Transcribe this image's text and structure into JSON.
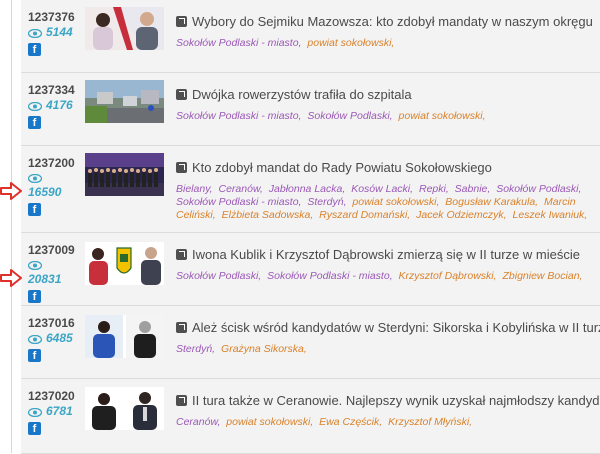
{
  "articles": [
    {
      "id": "1237376",
      "views": "5144",
      "fb_label": "f",
      "title": "Wybory do Sejmiku Mazowsza: kto zdobył mandaty w naszym okręgu",
      "tags": [
        {
          "text": "Sokołów Podlaski - miasto,",
          "color": "purple"
        },
        {
          "text": "powiat sokołowski,",
          "color": "orange"
        }
      ]
    },
    {
      "id": "1237334",
      "views": "4176",
      "fb_label": "f",
      "title": "Dwójka rowerzystów trafiła do szpitala",
      "tags": [
        {
          "text": "Sokołów Podlaski - miasto,",
          "color": "purple"
        },
        {
          "text": "Sokołów Podlaski,",
          "color": "purple"
        },
        {
          "text": "powiat sokołowski,",
          "color": "orange"
        }
      ]
    },
    {
      "id": "1237200",
      "views": "16590",
      "fb_label": "f",
      "title": "Kto zdobył mandat do Rady Powiatu Sokołowskiego",
      "tags": [
        {
          "text": "Bielany,",
          "color": "purple"
        },
        {
          "text": "Ceranów,",
          "color": "purple"
        },
        {
          "text": "Jabłonna Lacka,",
          "color": "purple"
        },
        {
          "text": "Kosów Lacki,",
          "color": "purple"
        },
        {
          "text": "Repki,",
          "color": "purple"
        },
        {
          "text": "Sabnie,",
          "color": "purple"
        },
        {
          "text": "Sokołów Podlaski,",
          "color": "purple"
        },
        {
          "text": "Sokołów Podlaski - miasto,",
          "color": "purple"
        },
        {
          "text": "Sterdyń,",
          "color": "purple"
        },
        {
          "text": "powiat sokołowski,",
          "color": "orange"
        },
        {
          "text": "Bogusław Karakula,",
          "color": "orange"
        },
        {
          "text": "Marcin Celiński,",
          "color": "orange"
        },
        {
          "text": "Elżbieta Sadowska,",
          "color": "orange"
        },
        {
          "text": "Ryszard Domański,",
          "color": "orange"
        },
        {
          "text": "Jacek Odziemczyk,",
          "color": "orange"
        },
        {
          "text": "Leszek Iwaniuk,",
          "color": "orange"
        }
      ]
    },
    {
      "id": "1237009",
      "views": "20831",
      "fb_label": "f",
      "title": "Iwona Kublik i Krzysztof Dąbrowski zmierzą się w II turze w mieście",
      "tags": [
        {
          "text": "Sokołów Podlaski,",
          "color": "purple"
        },
        {
          "text": "Sokołów Podlaski - miasto,",
          "color": "purple"
        },
        {
          "text": "Krzysztof Dąbrowski,",
          "color": "orange"
        },
        {
          "text": "Zbigniew Bocian,",
          "color": "orange"
        }
      ]
    },
    {
      "id": "1237016",
      "views": "6485",
      "fb_label": "f",
      "title": "Ależ ścisk wśród kandydatów w Sterdyni: Sikorska i Kobylińska w II turze",
      "tags": [
        {
          "text": "Sterdyń,",
          "color": "purple"
        },
        {
          "text": "Grażyna Sikorska,",
          "color": "orange"
        }
      ]
    },
    {
      "id": "1237020",
      "views": "6781",
      "fb_label": "f",
      "title": "II tura także w Ceranowie. Najlepszy wynik uzyskał najmłodszy kandydat.",
      "tags": [
        {
          "text": "Ceranów,",
          "color": "purple"
        },
        {
          "text": "powiat sokołowski,",
          "color": "orange"
        },
        {
          "text": "Ewa Częścik,",
          "color": "orange"
        },
        {
          "text": "Krzysztof Młyński,",
          "color": "orange"
        }
      ]
    }
  ],
  "colors": {
    "tag_purple": "#9b59b6",
    "tag_orange": "#d9822b",
    "views": "#3ba5c6",
    "facebook": "#1877c9",
    "arrow": "#e0302a"
  },
  "icons": [
    "eye-icon",
    "facebook-icon",
    "external-link-icon",
    "red-arrow-icon"
  ]
}
